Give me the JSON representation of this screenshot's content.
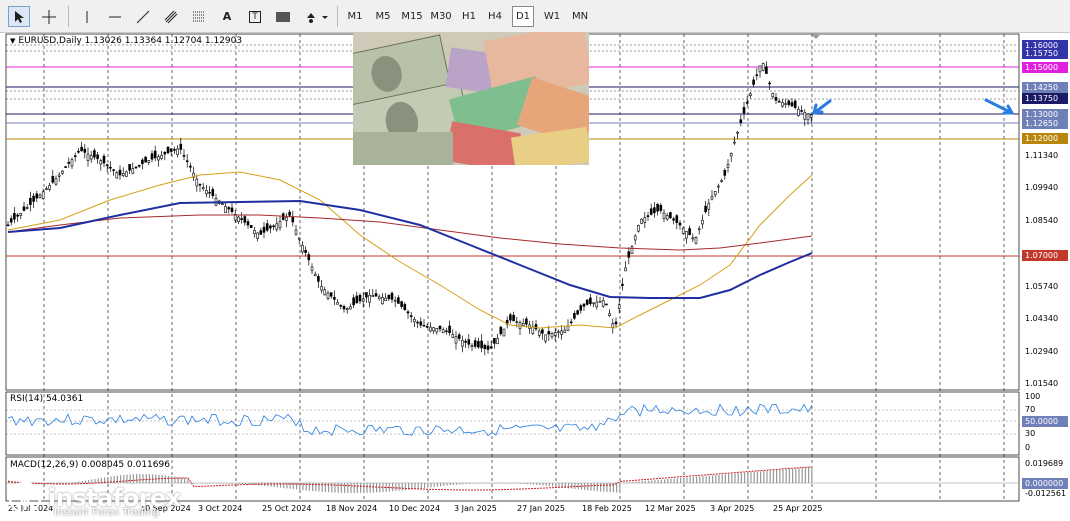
{
  "toolbar": {
    "tools": [
      {
        "name": "cursor-tool",
        "icon": "cursor-arrow-icon"
      },
      {
        "name": "crosshair-tool",
        "icon": "crosshair-icon"
      },
      {
        "name": "vertical-line-tool",
        "icon": "vertical-line-icon"
      },
      {
        "name": "horizontal-line-tool",
        "icon": "horizontal-line-icon"
      },
      {
        "name": "trendline-tool",
        "icon": "trendline-icon"
      },
      {
        "name": "channel-tool",
        "icon": "equidistant-channel-icon"
      },
      {
        "name": "fibonacci-tool",
        "icon": "fibonacci-icon"
      },
      {
        "name": "text-tool",
        "icon": "text-icon",
        "label": "A"
      },
      {
        "name": "text-label-tool",
        "icon": "text-label-icon",
        "label": "T"
      },
      {
        "name": "rectangle-tool",
        "icon": "rectangle-icon"
      },
      {
        "name": "shapes-menu-tool",
        "icon": "shapes-menu-icon"
      }
    ],
    "timeframes": [
      "M1",
      "M5",
      "M15",
      "M30",
      "H1",
      "H4",
      "D1",
      "W1",
      "MN"
    ],
    "active_timeframe": "D1"
  },
  "chart": {
    "symbol_header": "EURUSD,Daily  1.13026 1.13364 1.12704 1.12903",
    "price_levels": [
      {
        "label": "1.16000",
        "bg": "#3333aa"
      },
      {
        "label": "1.15750",
        "bg": "#3333aa"
      },
      {
        "label": "1.15000",
        "bg": "#e020e0"
      },
      {
        "label": "1.14250",
        "bg": "#6f7fb8"
      },
      {
        "label": "1.13750",
        "bg": "#1a1a66"
      },
      {
        "label": "1.13000",
        "bg": "#6f7fb8"
      },
      {
        "label": "1.12650",
        "bg": "#6f7fb8"
      },
      {
        "label": "1.12000",
        "bg": "#b8860b"
      },
      {
        "label": "1.07000",
        "bg": "#c0392b"
      }
    ],
    "axis_ticks": [
      "1.11340",
      "1.09940",
      "1.08540",
      "1.07000",
      "1.05740",
      "1.04340",
      "1.02940",
      "1.01540"
    ],
    "dates": [
      "25 Jul 2024",
      "10 Sep 2024",
      "3 Oct 2024",
      "25 Oct 2024",
      "18 Nov 2024",
      "10 Dec 2024",
      "3 Jan 2025",
      "27 Jan 2025",
      "18 Feb 2025",
      "12 Mar 2025",
      "3 Apr 2025",
      "25 Apr 2025"
    ],
    "colors": {
      "grid": "#000000",
      "bull": "#000000",
      "bear": "#000000",
      "ma_slow": "#1f2fa0",
      "ma_mid": "#a52a2a",
      "ma_fast": "#d4a017",
      "arrow": "#2a7de1"
    }
  },
  "rsi": {
    "label": "RSI(14) 54.0361",
    "levels": [
      "100",
      "70",
      "50.0000",
      "30",
      "0"
    ]
  },
  "macd": {
    "label": "MACD(12,26,9) 0.008045 0.011696",
    "levels": [
      "0.019689",
      "0.000000",
      "-0.012561"
    ]
  },
  "branding": {
    "name": "instaforex",
    "tagline": "Instant Forex Trading"
  }
}
